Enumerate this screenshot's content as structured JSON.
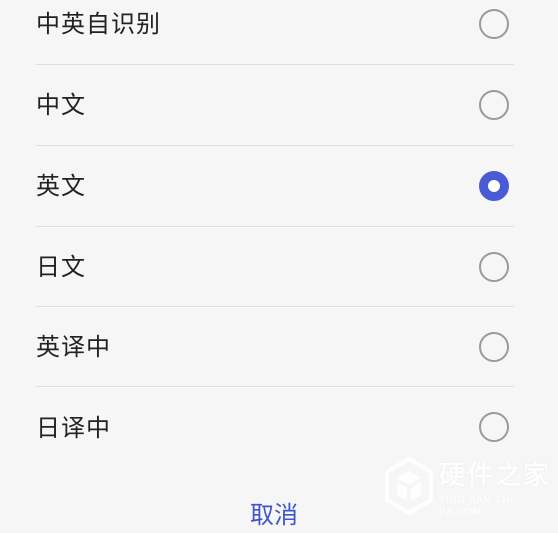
{
  "options": [
    {
      "label": "中英自识别",
      "selected": false
    },
    {
      "label": "中文",
      "selected": false
    },
    {
      "label": "英文",
      "selected": true
    },
    {
      "label": "日文",
      "selected": false
    },
    {
      "label": "英译中",
      "selected": false
    },
    {
      "label": "日译中",
      "selected": false
    }
  ],
  "cancel_label": "取消",
  "accent_color": "#4a5bd6",
  "watermark": {
    "title": "硬件之家",
    "subtitle": "YING JIAN ZHI JIA.COM"
  }
}
